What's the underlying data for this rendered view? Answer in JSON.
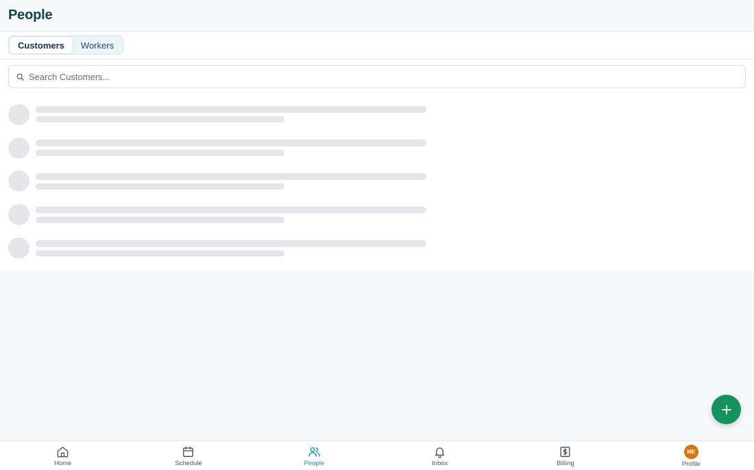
{
  "header": {
    "title": "People"
  },
  "tabs": [
    {
      "label": "Customers",
      "active": true
    },
    {
      "label": "Workers",
      "active": false
    }
  ],
  "search": {
    "placeholder": "Search Customers...",
    "value": ""
  },
  "list": {
    "loading": true,
    "skeleton_rows": 5
  },
  "fab": {
    "icon": "plus-icon",
    "color": "#13915f"
  },
  "bottom_nav": [
    {
      "label": "Home",
      "icon": "home-icon",
      "active": false
    },
    {
      "label": "Schedule",
      "icon": "calendar-icon",
      "active": false
    },
    {
      "label": "People",
      "icon": "people-icon",
      "active": true
    },
    {
      "label": "Inbox",
      "icon": "bell-icon",
      "active": false
    },
    {
      "label": "Billing",
      "icon": "dollar-receipt-icon",
      "active": false
    },
    {
      "label": "Profile",
      "icon": "avatar",
      "avatar_initials": "ME",
      "active": false
    }
  ],
  "colors": {
    "title": "#14424f",
    "accent_active": "#1a8fb4",
    "fab": "#13915f",
    "avatar": "#d8750c"
  }
}
